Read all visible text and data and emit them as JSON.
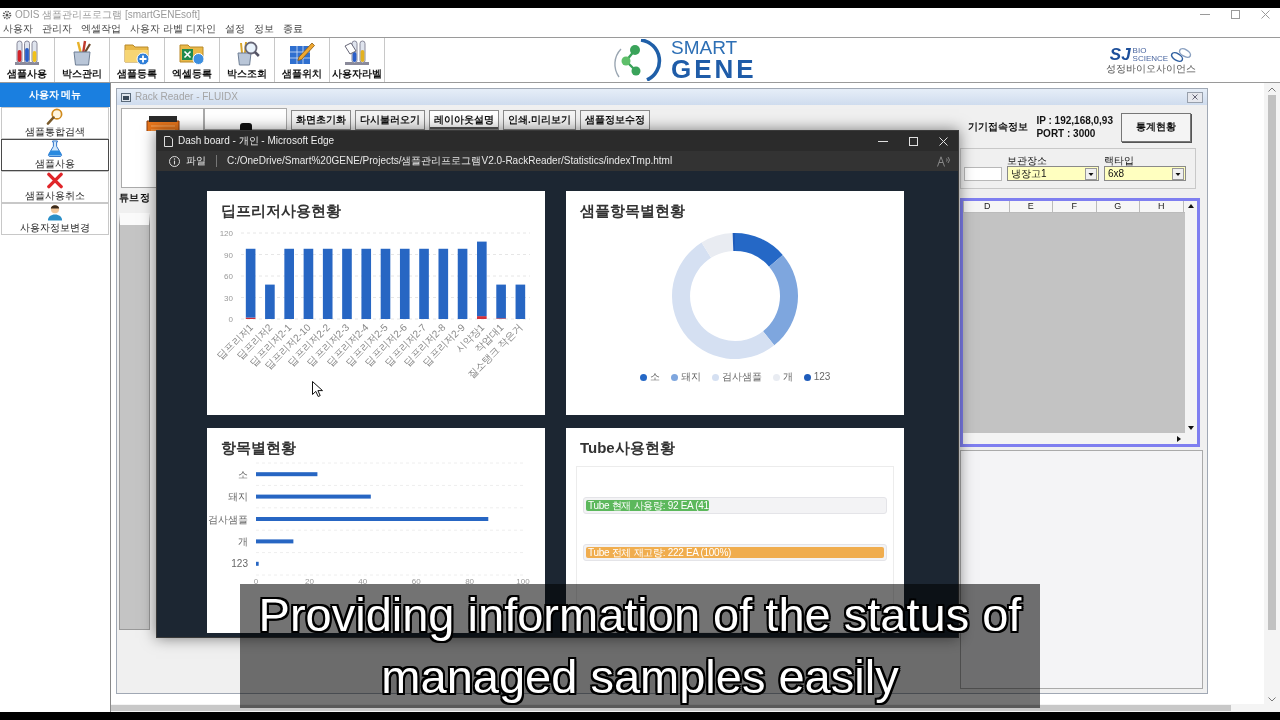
{
  "app": {
    "title": "ODIS 샘플관리프로그램 [smartGENEsoft]"
  },
  "menu": [
    "사용자",
    "관리자",
    "엑셀작업",
    "사용자 라벨 디자인",
    "설정",
    "정보",
    "종료"
  ],
  "toolbar": [
    "샘플사용",
    "박스관리",
    "샘플등록",
    "엑셀등록",
    "박스조회",
    "샘플위치",
    "사용자라벨"
  ],
  "logo": {
    "line_1": "SMART",
    "line_2": "GENE"
  },
  "company_logo": {
    "mark": "SJ",
    "tag_1": "BIO",
    "tag_2": "SCIENCE",
    "name": "성정바이오사이언스"
  },
  "sidebar": {
    "title": "사용자 메뉴",
    "items": [
      {
        "label": "샘플통합검색",
        "selected": false
      },
      {
        "label": "샘플사용",
        "selected": true
      },
      {
        "label": "샘플사용취소",
        "selected": false
      },
      {
        "label": "사용자정보변경",
        "selected": false
      }
    ]
  },
  "rack_window": {
    "title": "Rack Reader - FLUIDX",
    "buttons": [
      {
        "label": "화면초기화",
        "focused": false
      },
      {
        "label": "다시불러오기",
        "focused": false
      },
      {
        "label": "레이아웃설명",
        "focused": true
      },
      {
        "label": "인쇄.미리보기",
        "focused": false
      },
      {
        "label": "샘플정보수정",
        "focused": false
      }
    ],
    "connection_label": "기기접속정보",
    "ip": "IP : 192,168,0,93",
    "port": "PORT : 3000",
    "stats_button": "통계현황",
    "fields": [
      {
        "label": "보관장소",
        "value": "냉장고1"
      },
      {
        "label": "랙타입",
        "value": "6x8"
      }
    ],
    "group_label": "튜브 정",
    "grid_columns": [
      "D",
      "E",
      "F",
      "G",
      "H"
    ]
  },
  "browser": {
    "title": "Dash board - 개인 - Microsoft Edge",
    "scheme": "파일",
    "url": "C:/OneDrive/Smart%20GENE/Projects/샘플관리프로그램V2.0-RackReader/Statistics/indexTmp.html",
    "cards": [
      {
        "kind": "chart",
        "chart_data": {
          "type": "bar",
          "title": "딥프리저사용현황",
          "categories": [
            "딥프리저1",
            "딥프리저2",
            "딥프리저2-1",
            "딥프리저2-10",
            "딥프리저2-2",
            "딥프리저2-3",
            "딥프리저2-4",
            "딥프리저2-5",
            "딥프리저2-6",
            "딥프리저2-7",
            "딥프리저2-8",
            "딥프리저2-9",
            "시약장1",
            "작업대1",
            "질소탱크 작은거"
          ],
          "series": [
            {
              "color": "#d12f3a",
              "values": [
                2,
                0,
                0,
                0,
                0,
                0,
                0,
                0,
                0,
                0,
                0,
                0,
                4,
                1,
                0
              ]
            },
            {
              "color": "#2766c3",
              "values": [
                96,
                48,
                98,
                98,
                98,
                98,
                98,
                98,
                98,
                98,
                98,
                98,
                104,
                47,
                48
              ]
            }
          ],
          "ylim": [
            0,
            120
          ],
          "yticks": [
            0,
            30,
            60,
            90,
            120
          ],
          "stacked": true,
          "grid": true
        }
      },
      {
        "kind": "chart",
        "chart_data": {
          "type": "donut",
          "title": "샘플항목별현황",
          "categories": [
            "소",
            "돼지",
            "검사샘플",
            "개",
            "123"
          ],
          "values": [
            13.7,
            25.6,
            51.8,
            8.3,
            0.6
          ]
        },
        "legend": [
          {
            "color": "#2568c6"
          },
          {
            "color": "#7ea6de"
          },
          {
            "color": "#d5e0f2"
          },
          {
            "color": "#e9ecf2"
          },
          {
            "color": "#1f5cbb"
          }
        ]
      },
      {
        "kind": "chart",
        "chart_data": {
          "type": "bar",
          "orientation": "horizontal",
          "title": "항목별현황",
          "categories": [
            "소",
            "돼지",
            "검사샘플",
            "개",
            "123"
          ],
          "series": [
            {
              "color": "#2766c3",
              "values": [
                23,
                43,
                87,
                14,
                1
              ]
            }
          ],
          "xlim": [
            0,
            100
          ],
          "xticks": [
            0,
            20,
            40,
            60,
            80,
            100
          ],
          "grid": true
        }
      },
      {
        "kind": "progress",
        "title": "Tube사용현황",
        "bars": [
          {
            "label": "Tube 현재 사용량: 92 EA (41",
            "level": 0.414,
            "color": "#5cb85c"
          },
          {
            "label": "Tube 전체 재고량: 222 EA (100%)",
            "level": 1,
            "color": "#f0ad4e"
          }
        ]
      }
    ]
  },
  "caption": "Providing information of the status of managed samples easily"
}
